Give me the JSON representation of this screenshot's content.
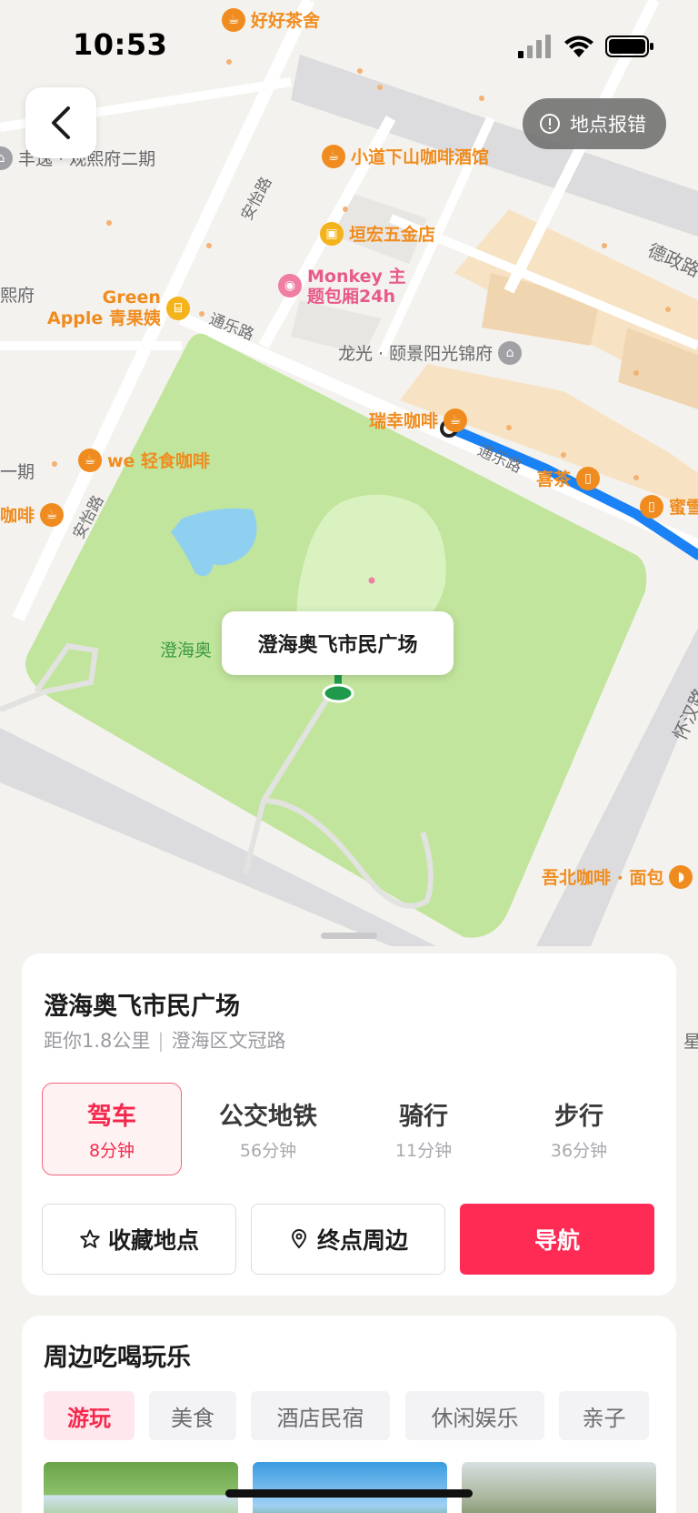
{
  "status_bar": {
    "time": "10:53"
  },
  "map": {
    "report_button": "地点报错",
    "roads": {
      "anyi_upper": "安怡路",
      "anyi_lower": "安怡路",
      "tongle_upper": "通乐路",
      "tongle_route": "通乐路",
      "dezheng": "德政路",
      "huaihan": "怀汉路"
    },
    "pois": {
      "haohao_tea": "好好茶舍",
      "xiaodao_coffee": "小道下山咖啡酒馆",
      "yuanhong_hardware": "垣宏五金店",
      "monkey_line1": "Monkey 主",
      "monkey_line2": "题包厢24h",
      "green_apple_line1": "Green",
      "green_apple_line2": "Apple 青果姨",
      "longguang": "龙光 · 颐景阳光锦府",
      "luckin": "瑞幸咖啡",
      "we_coffee": "we 轻食咖啡",
      "xicha": "喜茶",
      "mixue": "蜜雪",
      "wubei": "吾北咖啡 · 面包",
      "fengtu": "丰逸 · 观熙府二期",
      "left_fu": "熙府",
      "left_yiqi": "一期",
      "left_coffee": "咖啡",
      "park_label": "澄海奥",
      "right_star": "星"
    },
    "callout": "澄海奥飞市民广场"
  },
  "place": {
    "name": "澄海奥飞市民广场",
    "distance": "距你1.8公里",
    "separator": "|",
    "address": "澄海区文冠路"
  },
  "modes": [
    {
      "label": "驾车",
      "time": "8分钟"
    },
    {
      "label": "公交地铁",
      "time": "56分钟"
    },
    {
      "label": "骑行",
      "time": "11分钟"
    },
    {
      "label": "步行",
      "time": "36分钟"
    }
  ],
  "actions": {
    "favorite": "收藏地点",
    "nearby": "终点周边",
    "navigate": "导航"
  },
  "nearby": {
    "title": "周边吃喝玩乐",
    "chips": [
      "游玩",
      "美食",
      "酒店民宿",
      "休闲娱乐",
      "亲子"
    ]
  },
  "colors": {
    "accent": "#fe2c55",
    "route": "#1a82f5",
    "park": "#c1e59c",
    "poi": "#f08c1f"
  }
}
